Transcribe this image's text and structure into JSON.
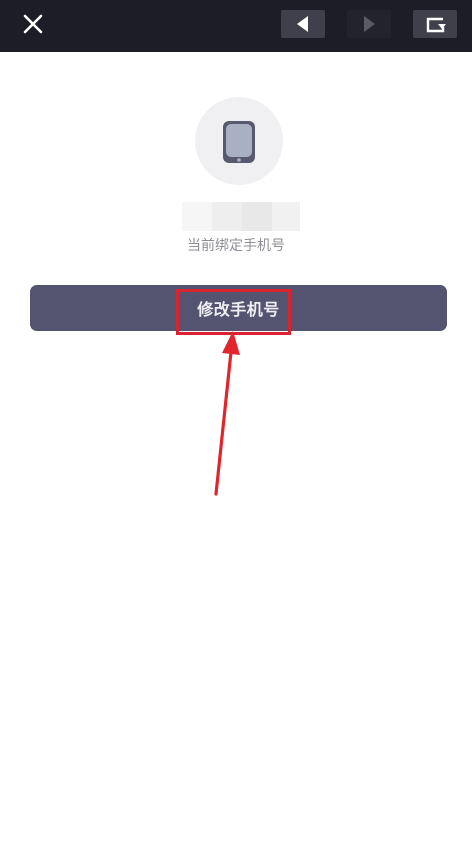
{
  "toolbar": {
    "close_icon": "close-icon",
    "back_icon": "triangle-left-icon",
    "forward_icon": "triangle-right-icon",
    "refresh_icon": "refresh-icon"
  },
  "account": {
    "avatar_icon": "smartphone-icon",
    "phone_number_masked": "",
    "caption": "当前绑定手机号"
  },
  "actions": {
    "change_phone_label": "修改手机号"
  },
  "annotation": {
    "highlight_color": "#d9232d",
    "arrow_color": "#e0262c"
  },
  "colors": {
    "toolbar_bg": "#1d1d27",
    "button_bg": "#555470",
    "button_text": "#eeeef4",
    "caption_text": "#8e8e96"
  }
}
